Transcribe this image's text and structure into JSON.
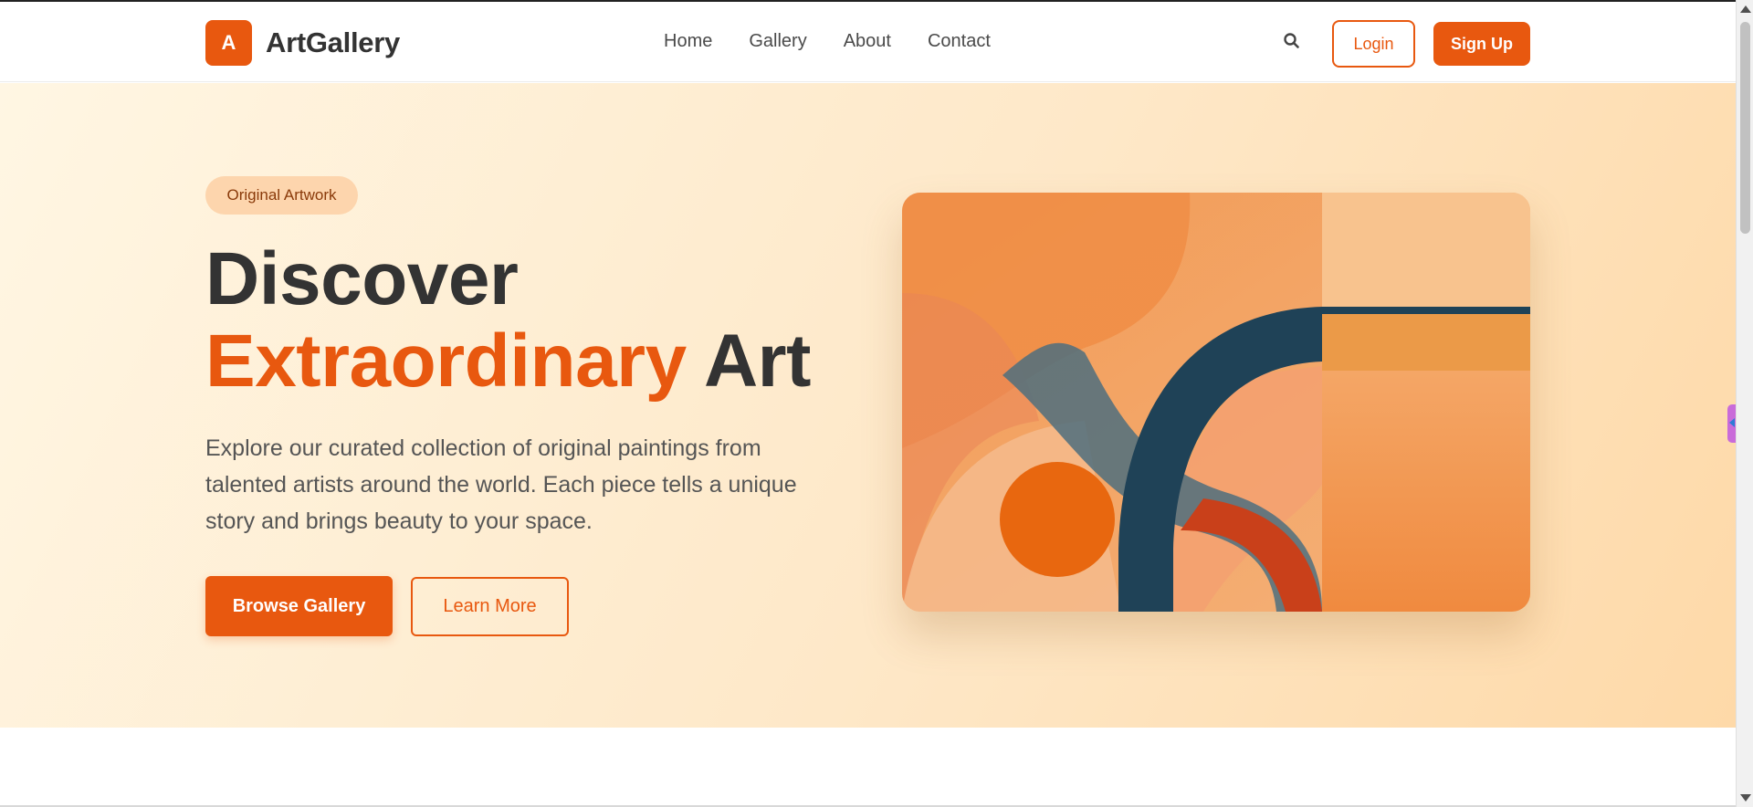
{
  "brand": {
    "logo_letter": "A",
    "name": "ArtGallery",
    "color": "#e8580f"
  },
  "nav": {
    "links": [
      "Home",
      "Gallery",
      "About",
      "Contact"
    ],
    "search_icon": "search-icon",
    "login_label": "Login",
    "signup_label": "Sign Up"
  },
  "hero": {
    "badge": "Original Artwork",
    "headline_line1": "Discover",
    "headline_accent": "Extraordinary",
    "headline_rest": "Art",
    "description": "Explore our curated collection of original paintings from talented artists around the world. Each piece tells a unique story and brings beauty to your space.",
    "primary_button": "Browse Gallery",
    "secondary_button": "Learn More",
    "background_colors": [
      "#fff6e3",
      "#fed9a8"
    ]
  },
  "colors": {
    "accent": "#e8580f",
    "text_dark": "#333333",
    "text_muted": "#555555",
    "navy": "#1f4257"
  }
}
